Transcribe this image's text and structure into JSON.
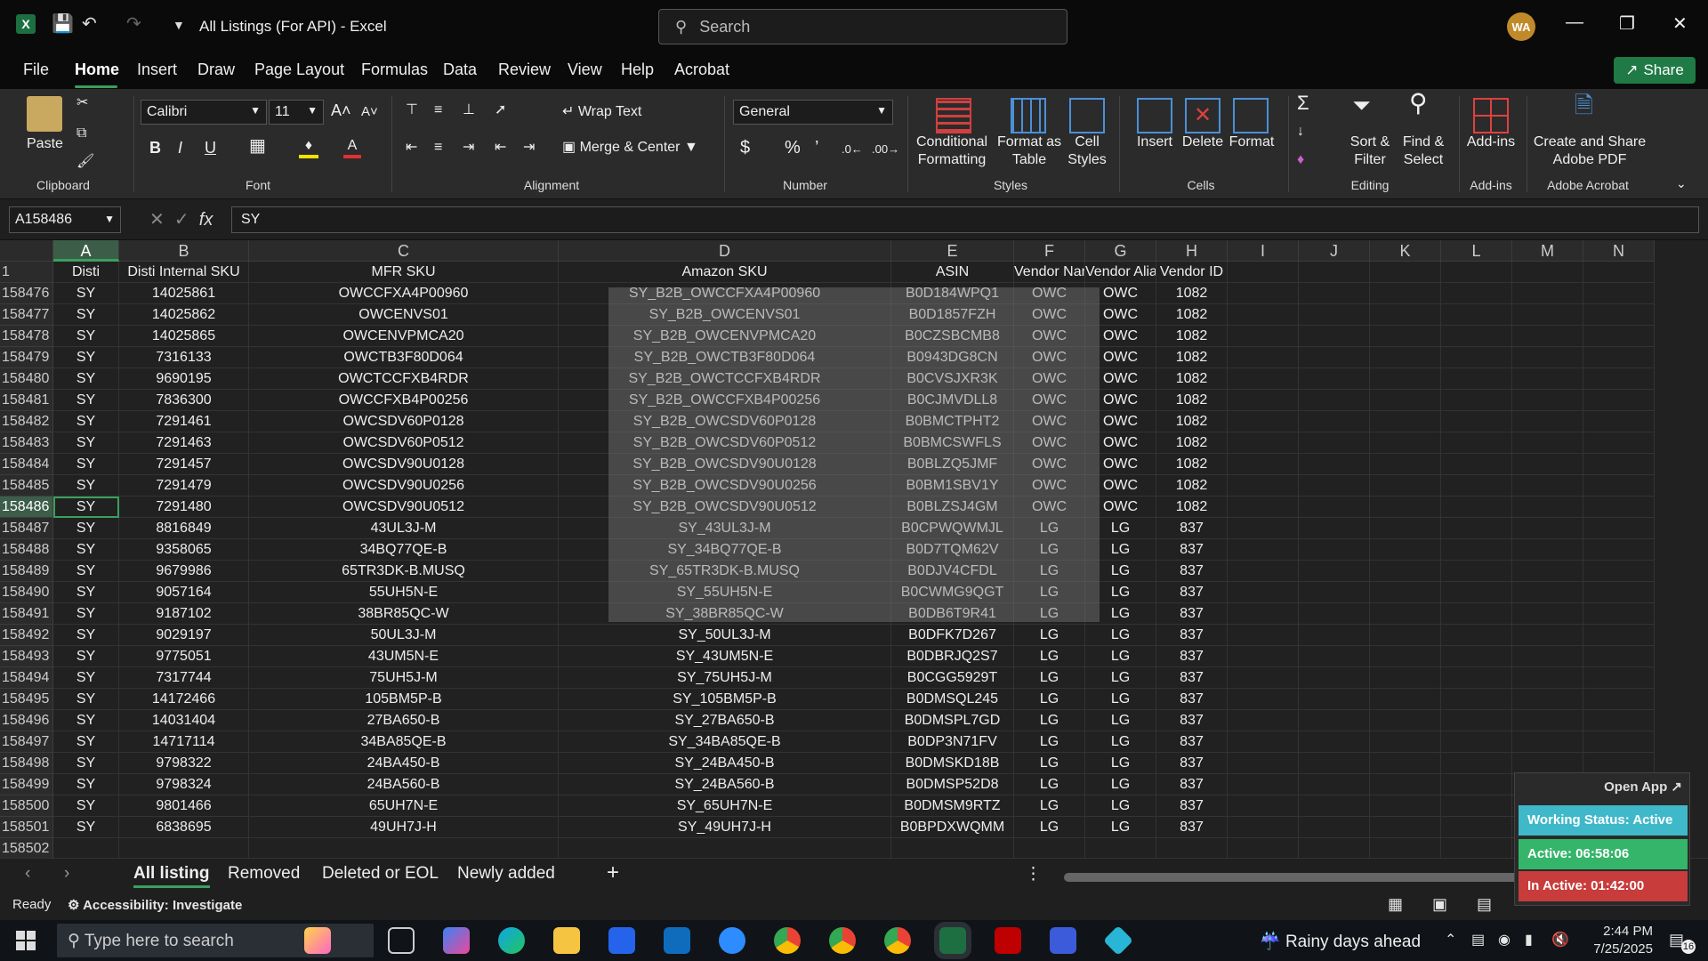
{
  "window": {
    "title": "All Listings (For API)  -  Excel",
    "search_placeholder": "Search",
    "avatar_initials": "WA"
  },
  "menu": {
    "items": [
      "File",
      "Home",
      "Insert",
      "Draw",
      "Page Layout",
      "Formulas",
      "Data",
      "Review",
      "View",
      "Help",
      "Acrobat"
    ],
    "active": "Home",
    "share_label": "Share"
  },
  "ribbon": {
    "clipboard": {
      "paste": "Paste",
      "group": "Clipboard"
    },
    "font": {
      "name": "Calibri",
      "size": "11",
      "group": "Font"
    },
    "alignment": {
      "wrap": "Wrap Text",
      "merge": "Merge & Center",
      "group": "Alignment"
    },
    "number": {
      "format": "General",
      "group": "Number"
    },
    "styles": {
      "conditional": "Conditional Formatting",
      "format_table": "Format as Table",
      "cell_styles": "Cell Styles",
      "group": "Styles"
    },
    "cells": {
      "insert": "Insert",
      "delete": "Delete",
      "format": "Format",
      "group": "Cells"
    },
    "editing": {
      "sort": "Sort & Filter",
      "find": "Find & Select",
      "group": "Editing"
    },
    "addins": {
      "label": "Add-ins",
      "group": "Add-ins"
    },
    "acrobat": {
      "label": "Create and Share Adobe PDF",
      "group": "Adobe Acrobat"
    }
  },
  "formula_bar": {
    "name_box": "A158486",
    "content": "SY"
  },
  "columns": [
    "A",
    "B",
    "C",
    "D",
    "E",
    "F",
    "G",
    "H",
    "I",
    "J",
    "K",
    "L",
    "M",
    "N"
  ],
  "header_row": {
    "row": "1",
    "cells": [
      "Disti",
      "Disti Internal SKU",
      "MFR SKU",
      "Amazon SKU",
      "ASIN",
      "Vendor Nam",
      "Vendor Alia",
      "Vendor ID"
    ]
  },
  "rows": [
    {
      "n": "158476",
      "c": [
        "SY",
        "14025861",
        "OWCCFXA4P00960",
        "SY_B2B_OWCCFXA4P00960",
        "B0D184WPQ1",
        "OWC",
        "OWC",
        "1082"
      ]
    },
    {
      "n": "158477",
      "c": [
        "SY",
        "14025862",
        "OWCENVS01",
        "SY_B2B_OWCENVS01",
        "B0D1857FZH",
        "OWC",
        "OWC",
        "1082"
      ]
    },
    {
      "n": "158478",
      "c": [
        "SY",
        "14025865",
        "OWCENVPMCA20",
        "SY_B2B_OWCENVPMCA20",
        "B0CZSBCMB8",
        "OWC",
        "OWC",
        "1082"
      ]
    },
    {
      "n": "158479",
      "c": [
        "SY",
        "7316133",
        "OWCTB3F80D064",
        "SY_B2B_OWCTB3F80D064",
        "B0943DG8CN",
        "OWC",
        "OWC",
        "1082"
      ]
    },
    {
      "n": "158480",
      "c": [
        "SY",
        "9690195",
        "OWCTCCFXB4RDR",
        "SY_B2B_OWCTCCFXB4RDR",
        "B0CVSJXR3K",
        "OWC",
        "OWC",
        "1082"
      ]
    },
    {
      "n": "158481",
      "c": [
        "SY",
        "7836300",
        "OWCCFXB4P00256",
        "SY_B2B_OWCCFXB4P00256",
        "B0CJMVDLL8",
        "OWC",
        "OWC",
        "1082"
      ]
    },
    {
      "n": "158482",
      "c": [
        "SY",
        "7291461",
        "OWCSDV60P0128",
        "SY_B2B_OWCSDV60P0128",
        "B0BMCTPHT2",
        "OWC",
        "OWC",
        "1082"
      ]
    },
    {
      "n": "158483",
      "c": [
        "SY",
        "7291463",
        "OWCSDV60P0512",
        "SY_B2B_OWCSDV60P0512",
        "B0BMCSWFLS",
        "OWC",
        "OWC",
        "1082"
      ]
    },
    {
      "n": "158484",
      "c": [
        "SY",
        "7291457",
        "OWCSDV90U0128",
        "SY_B2B_OWCSDV90U0128",
        "B0BLZQ5JMF",
        "OWC",
        "OWC",
        "1082"
      ]
    },
    {
      "n": "158485",
      "c": [
        "SY",
        "7291479",
        "OWCSDV90U0256",
        "SY_B2B_OWCSDV90U0256",
        "B0BM1SBV1Y",
        "OWC",
        "OWC",
        "1082"
      ]
    },
    {
      "n": "158486",
      "c": [
        "SY",
        "7291480",
        "OWCSDV90U0512",
        "SY_B2B_OWCSDV90U0512",
        "B0BLZSJ4GM",
        "OWC",
        "OWC",
        "1082"
      ]
    },
    {
      "n": "158487",
      "c": [
        "SY",
        "8816849",
        "43UL3J-M",
        "SY_43UL3J-M",
        "B0CPWQWMJL",
        "LG",
        "LG",
        "837"
      ]
    },
    {
      "n": "158488",
      "c": [
        "SY",
        "9358065",
        "34BQ77QE-B",
        "SY_34BQ77QE-B",
        "B0D7TQM62V",
        "LG",
        "LG",
        "837"
      ]
    },
    {
      "n": "158489",
      "c": [
        "SY",
        "9679986",
        "65TR3DK-B.MUSQ",
        "SY_65TR3DK-B.MUSQ",
        "B0DJV4CFDL",
        "LG",
        "LG",
        "837"
      ]
    },
    {
      "n": "158490",
      "c": [
        "SY",
        "9057164",
        "55UH5N-E",
        "SY_55UH5N-E",
        "B0CWMG9QGT",
        "LG",
        "LG",
        "837"
      ]
    },
    {
      "n": "158491",
      "c": [
        "SY",
        "9187102",
        "38BR85QC-W",
        "SY_38BR85QC-W",
        "B0DB6T9R41",
        "LG",
        "LG",
        "837"
      ]
    },
    {
      "n": "158492",
      "c": [
        "SY",
        "9029197",
        "50UL3J-M",
        "SY_50UL3J-M",
        "B0DFK7D267",
        "LG",
        "LG",
        "837"
      ]
    },
    {
      "n": "158493",
      "c": [
        "SY",
        "9775051",
        "43UM5N-E",
        "SY_43UM5N-E",
        "B0DBRJQ2S7",
        "LG",
        "LG",
        "837"
      ]
    },
    {
      "n": "158494",
      "c": [
        "SY",
        "7317744",
        "75UH5J-M",
        "SY_75UH5J-M",
        "B0CGG5929T",
        "LG",
        "LG",
        "837"
      ]
    },
    {
      "n": "158495",
      "c": [
        "SY",
        "14172466",
        "105BM5P-B",
        "SY_105BM5P-B",
        "B0DMSQL245",
        "LG",
        "LG",
        "837"
      ]
    },
    {
      "n": "158496",
      "c": [
        "SY",
        "14031404",
        "27BA650-B",
        "SY_27BA650-B",
        "B0DMSPL7GD",
        "LG",
        "LG",
        "837"
      ]
    },
    {
      "n": "158497",
      "c": [
        "SY",
        "14717114",
        "34BA85QE-B",
        "SY_34BA85QE-B",
        "B0DP3N71FV",
        "LG",
        "LG",
        "837"
      ]
    },
    {
      "n": "158498",
      "c": [
        "SY",
        "9798322",
        "24BA450-B",
        "SY_24BA450-B",
        "B0DMSKD18B",
        "LG",
        "LG",
        "837"
      ]
    },
    {
      "n": "158499",
      "c": [
        "SY",
        "9798324",
        "24BA560-B",
        "SY_24BA560-B",
        "B0DMSP52D8",
        "LG",
        "LG",
        "837"
      ]
    },
    {
      "n": "158500",
      "c": [
        "SY",
        "9801466",
        "65UH7N-E",
        "SY_65UH7N-E",
        "B0DMSM9RTZ",
        "LG",
        "LG",
        "837"
      ]
    },
    {
      "n": "158501",
      "c": [
        "SY",
        "6838695",
        "49UH7J-H",
        "SY_49UH7J-H",
        "B0BPDXWQMM",
        "LG",
        "LG",
        "837"
      ]
    },
    {
      "n": "158502",
      "c": [
        "",
        "",
        "",
        "",
        "",
        "",
        "",
        ""
      ]
    }
  ],
  "sheet_tabs": [
    "All listing",
    "Removed",
    "Deleted or EOL",
    "Newly added"
  ],
  "active_sheet": "All listing",
  "status": {
    "ready": "Ready",
    "accessibility": "Accessibility: Investigate"
  },
  "widget": {
    "open_app": "Open App",
    "working_status": "Working Status: Active",
    "active_time": "Active: 06:58:06",
    "inactive_time": "In Active: 01:42:00"
  },
  "taskbar": {
    "search_placeholder": "Type here to search",
    "weather": "Rainy days ahead",
    "time": "2:44 PM",
    "date": "7/25/2025",
    "notifications": "16"
  },
  "colors": {
    "accent": "#3aa05f",
    "share": "#1f7a45"
  }
}
